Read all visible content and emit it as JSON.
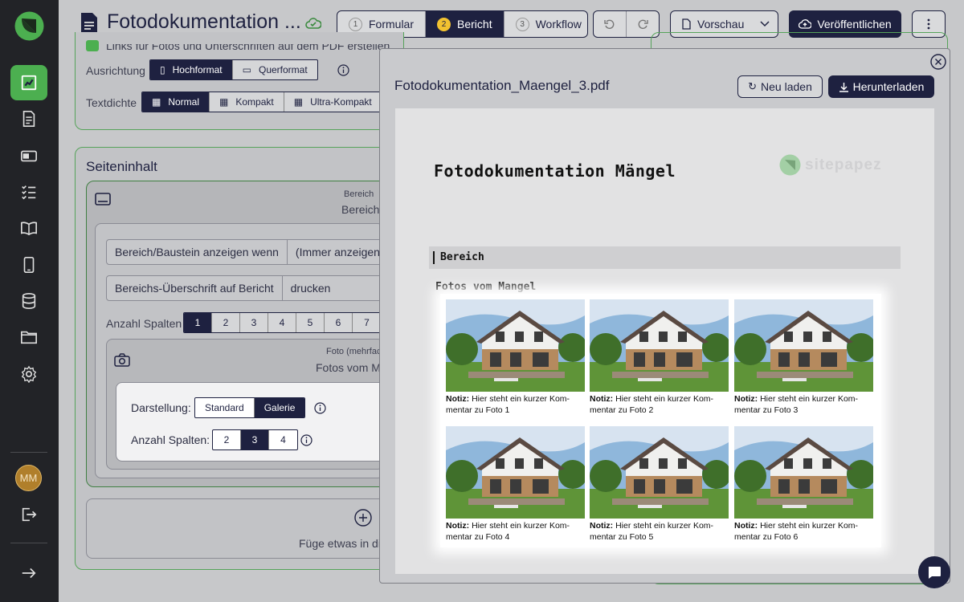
{
  "app": {
    "title": "Fotodokumentation ...",
    "avatar_initials": "MM"
  },
  "header": {
    "tabs": [
      {
        "num": "1",
        "label": "Formular"
      },
      {
        "num": "2",
        "label": "Bericht"
      },
      {
        "num": "3",
        "label": "Workflow"
      }
    ],
    "active_tab": "Bericht",
    "preview_label": "Vorschau",
    "publish_label": "Veröffentlichen"
  },
  "sidebar": {
    "icons": [
      "report-icon",
      "document-icon",
      "card-icon",
      "checklist-icon",
      "book-icon",
      "mobile-icon",
      "database-icon",
      "folder-icon",
      "settings-icon"
    ],
    "active": "report-icon"
  },
  "settings": {
    "links_label": "Links für Fotos und Unterschriften auf dem PDF erstellen",
    "orientation_label": "Ausrichtung",
    "orientation_options": [
      "Hochformat",
      "Querformat"
    ],
    "orientation_selected": "Hochformat",
    "density_label": "Textdichte",
    "density_options": [
      "Normal",
      "Kompakt",
      "Ultra-Kompakt"
    ],
    "density_selected": "Normal"
  },
  "content": {
    "section_title": "Seiteninhalt",
    "block_type": "Bereich",
    "block_name": "Bereich",
    "show_when_label": "Bereich/Baustein anzeigen wenn",
    "show_when_value": "(Immer anzeigen)",
    "heading_label": "Bereichs-Überschrift auf Bericht",
    "heading_value": "drucken",
    "columns_label": "Anzahl Spalten",
    "columns_options": [
      "1",
      "2",
      "3",
      "4",
      "5",
      "6",
      "7"
    ],
    "columns_selected": "1",
    "photo_type": "Foto (mehrfach)",
    "photo_name": "Fotos vom Mangel",
    "display_label": "Darstellung:",
    "display_options": [
      "Standard",
      "Galerie"
    ],
    "display_selected": "Galerie",
    "gallery_columns_label": "Anzahl Spalten:",
    "gallery_columns_options": [
      "2",
      "3",
      "4"
    ],
    "gallery_columns_selected": "3",
    "add_label": "Füge etwas in die"
  },
  "preview": {
    "filename": "Fotodokumentation_Maengel_3.pdf",
    "reload_label": "Neu laden",
    "download_label": "Herunterladen",
    "doc_title": "Fotodokumentation Mängel",
    "watermark": "sitepapez",
    "section_heading": "Bereich",
    "photos_heading": "Fotos vom Mangel",
    "photos": [
      {
        "note_label": "Notiz:",
        "note": "Hier steht ein kurzer Kom-",
        "note2": "mentar zu Foto 1"
      },
      {
        "note_label": "Notiz:",
        "note": "Hier steht ein kurzer Kom-",
        "note2": "mentar zu Foto 2"
      },
      {
        "note_label": "Notiz:",
        "note": "Hier steht ein kurzer Kom-",
        "note2": "mentar zu Foto 3"
      },
      {
        "note_label": "Notiz:",
        "note": "Hier steht ein kurzer Kom-",
        "note2": "mentar zu Foto 4"
      },
      {
        "note_label": "Notiz:",
        "note": "Hier steht ein kurzer Kom-",
        "note2": "mentar zu Foto 5"
      },
      {
        "note_label": "Notiz:",
        "note": "Hier steht ein kurzer Kom-",
        "note2": "mentar zu Foto 6"
      }
    ]
  },
  "colors": {
    "accent": "#4caf50",
    "navy": "#1e2140",
    "sidebar": "#222327",
    "badge": "#f2c230"
  }
}
